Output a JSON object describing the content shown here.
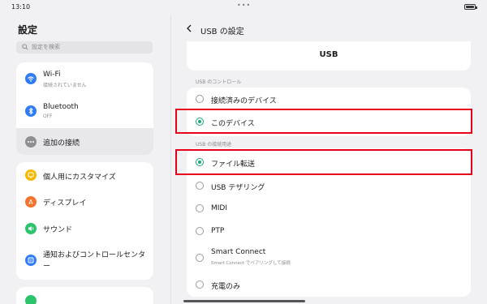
{
  "status_bar": {
    "time": "13:10",
    "dots": "•••"
  },
  "sidebar": {
    "title": "設定",
    "search_placeholder": "設定を検索",
    "group1": [
      {
        "label": "Wi-Fi",
        "sub": "接続されていません",
        "icon": "wifi-icon",
        "color": "#2f7cf6"
      },
      {
        "label": "Bluetooth",
        "sub": "OFF",
        "icon": "bluetooth-icon",
        "color": "#2f7cf6"
      },
      {
        "label": "追加の接続",
        "sub": "",
        "icon": "more-dots-icon",
        "color": "#8e8e93",
        "selected": true
      }
    ],
    "group2": [
      {
        "label": "個人用にカスタマイズ",
        "icon": "customize-icon",
        "color": "#f5b800"
      },
      {
        "label": "ディスプレイ",
        "icon": "display-icon",
        "color": "#f5732e"
      },
      {
        "label": "サウンド",
        "icon": "sound-icon",
        "color": "#2cc46b"
      },
      {
        "label": "通知およびコントロールセンター",
        "icon": "notification-icon",
        "color": "#2f7cf6"
      }
    ]
  },
  "main": {
    "back_label": "USB の設定",
    "usb_heading": "USB",
    "section_control": "USB のコントロール",
    "control_options": [
      {
        "label": "接続済みのデバイス",
        "selected": false
      },
      {
        "label": "このデバイス",
        "selected": true
      }
    ],
    "section_purpose": "USB の接続用途",
    "purpose_options": [
      {
        "label": "ファイル転送",
        "sub": "",
        "selected": true
      },
      {
        "label": "USB テザリング",
        "sub": "",
        "selected": false
      },
      {
        "label": "MIDI",
        "sub": "",
        "selected": false
      },
      {
        "label": "PTP",
        "sub": "",
        "selected": false
      },
      {
        "label": "Smart Connect",
        "sub": "Smart Connect でペアリングして接続",
        "selected": false
      },
      {
        "label": "充電のみ",
        "sub": "",
        "selected": false
      }
    ]
  },
  "colors": {
    "accent": "#1aa77b",
    "highlight": "#e8001a"
  }
}
